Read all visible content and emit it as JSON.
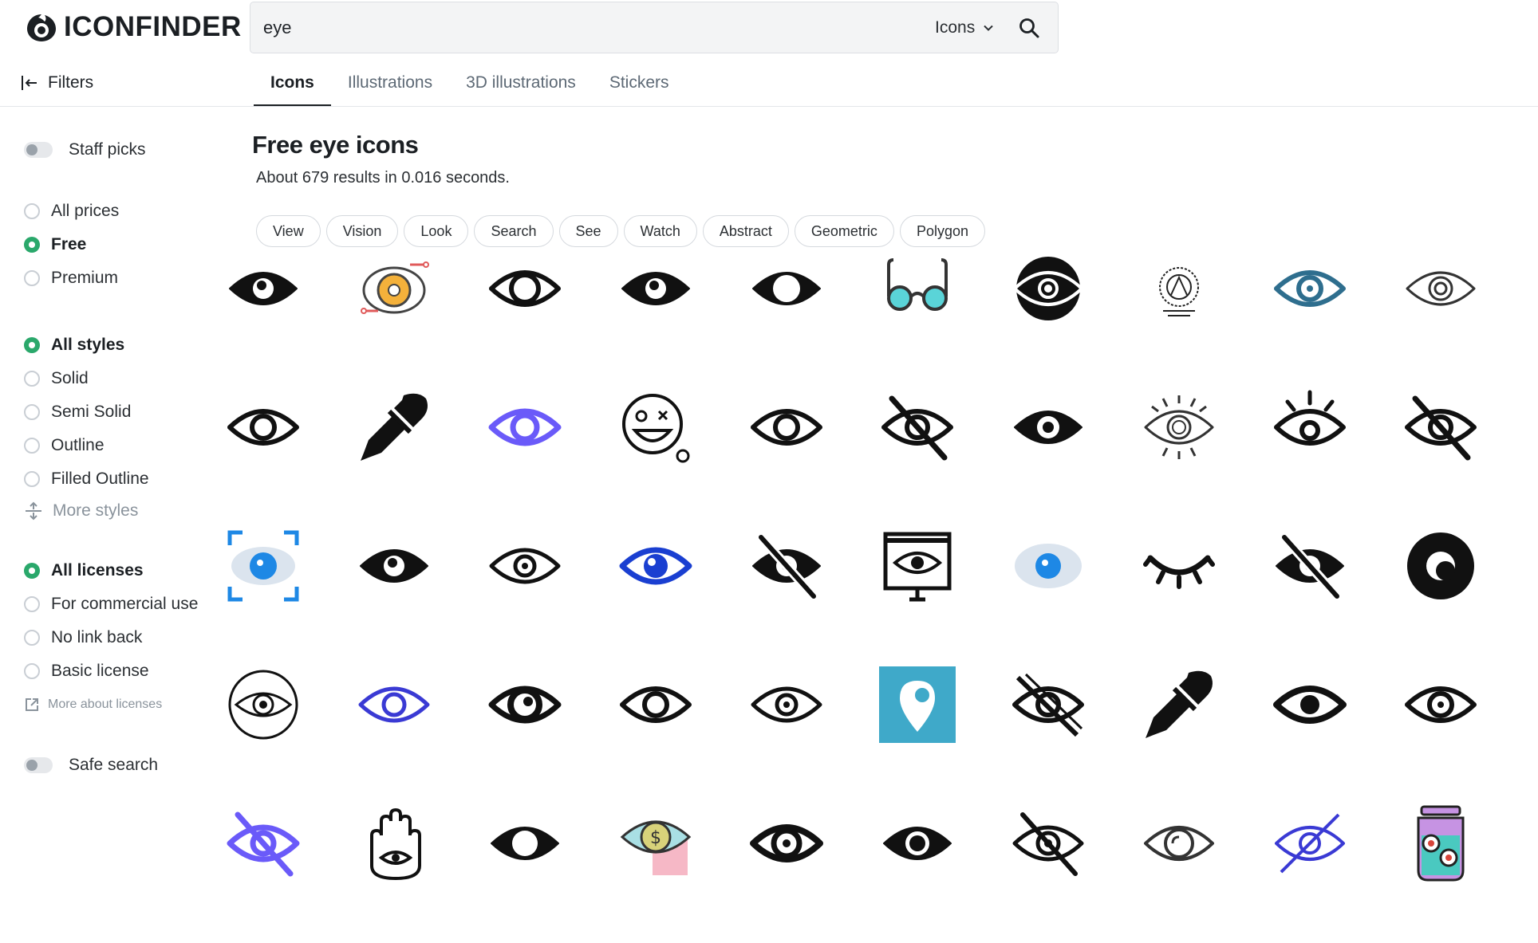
{
  "app": {
    "logo_text": "ICONFINDER"
  },
  "search": {
    "query": "eye",
    "type_label": "Icons"
  },
  "filters_toggle": {
    "label": "Filters"
  },
  "tabs": [
    {
      "label": "Icons",
      "active": true
    },
    {
      "label": "Illustrations",
      "active": false
    },
    {
      "label": "3D illustrations",
      "active": false
    },
    {
      "label": "Stickers",
      "active": false
    }
  ],
  "sidebar": {
    "staff_picks": "Staff picks",
    "prices": [
      "All prices",
      "Free",
      "Premium"
    ],
    "styles": [
      "All styles",
      "Solid",
      "Semi Solid",
      "Outline",
      "Filled Outline"
    ],
    "more_styles": "More styles",
    "licenses": [
      "All licenses",
      "For commercial use",
      "No link back",
      "Basic license"
    ],
    "more_licenses": "More about licenses",
    "safe_search": "Safe search"
  },
  "main": {
    "heading": "Free eye icons",
    "results": "About 679 results in 0.016 seconds.",
    "tags": [
      "View",
      "Vision",
      "Look",
      "Search",
      "See",
      "Watch",
      "Abstract",
      "Geometric",
      "Polygon"
    ]
  },
  "icons": [
    [
      "eye-solid",
      "eye-gear",
      "eye-outline-bold",
      "eye-solid",
      "eye-black-white-pupil",
      "glasses",
      "eye-circle-badge",
      "eye-ornate",
      "eye-blue",
      "eye-thin"
    ],
    [
      "eye-outline",
      "eyedropper",
      "eye-purple",
      "face-dizzy",
      "eye-outline",
      "eye-slash",
      "eye-circle-fill",
      "eye-rays",
      "eye-lashes",
      "eye-slash"
    ],
    [
      "eye-scan",
      "eye-solid",
      "eye-outline-small",
      "eye-blue-outline",
      "eye-slash-solid",
      "eye-presentation",
      "eye-light-blue",
      "eye-closed",
      "eye-slash-solid",
      "eye-ball"
    ],
    [
      "eye-in-circle",
      "eye-outline-blue",
      "eye-bold-ring",
      "eye-outline",
      "eye-outline-small",
      "eye-pin",
      "eye-slash-double",
      "eyedropper",
      "eye-solid-outline",
      "eye-ring"
    ],
    [
      "eye-slash-purple",
      "hamsa-hand",
      "eye-solid-large",
      "eye-dollar",
      "eye-bold",
      "eye-solid-dot",
      "eye-slash-outline",
      "eye-thin-gray",
      "eye-slash-blue",
      "jar-eyes"
    ]
  ],
  "colors": {
    "accent": "#2aa86b",
    "blue": "#1e88e5",
    "purple": "#6a5af9",
    "teal": "#3fa9c9"
  }
}
